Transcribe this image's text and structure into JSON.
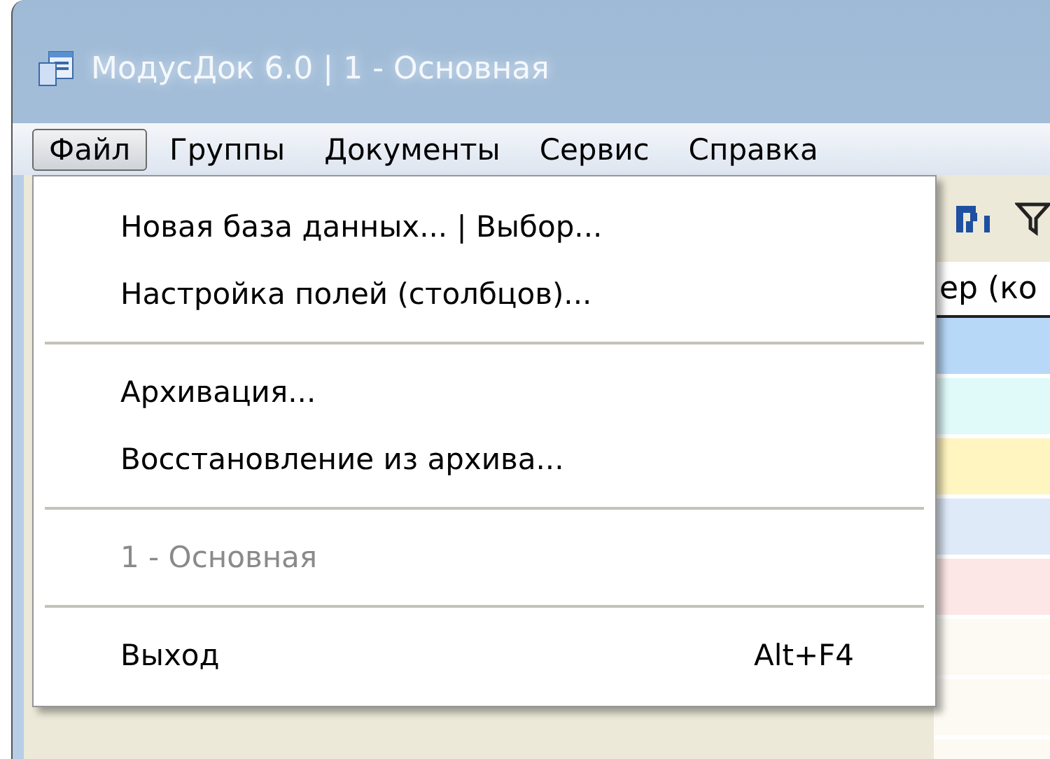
{
  "window": {
    "title": "МодусДок 6.0 | 1 - Основная"
  },
  "menubar": [
    {
      "label": "Файл",
      "selected": true
    },
    {
      "label": "Группы",
      "selected": false
    },
    {
      "label": "Документы",
      "selected": false
    },
    {
      "label": "Сервис",
      "selected": false
    },
    {
      "label": "Справка",
      "selected": false
    }
  ],
  "menu": [
    {
      "kind": "item",
      "label": "Новая база данных... | Выбор...",
      "disabled": false
    },
    {
      "kind": "item",
      "label": "Настройка полей (столбцов)...",
      "disabled": false
    },
    {
      "kind": "separator"
    },
    {
      "kind": "item",
      "label": "Архивация...",
      "disabled": false
    },
    {
      "kind": "item",
      "label": "Восстановление из архива...",
      "disabled": false
    },
    {
      "kind": "separator"
    },
    {
      "kind": "item",
      "label": "1 - Основная",
      "disabled": true
    },
    {
      "kind": "separator"
    },
    {
      "kind": "item",
      "label": "Выход",
      "shortcut": "Alt+F4",
      "disabled": false
    }
  ],
  "table": {
    "column_header": "ер (ко",
    "rows": [
      {
        "color": "#b8d8f8"
      },
      {
        "color": "#e0fafa"
      },
      {
        "color": "#fff5c0"
      },
      {
        "color": "#dfeaf8"
      },
      {
        "color": "#fde6e6"
      },
      {
        "color": "#fdfaf3"
      },
      {
        "color": "#fdfaf3"
      },
      {
        "color": "#fdfaf3"
      }
    ]
  }
}
